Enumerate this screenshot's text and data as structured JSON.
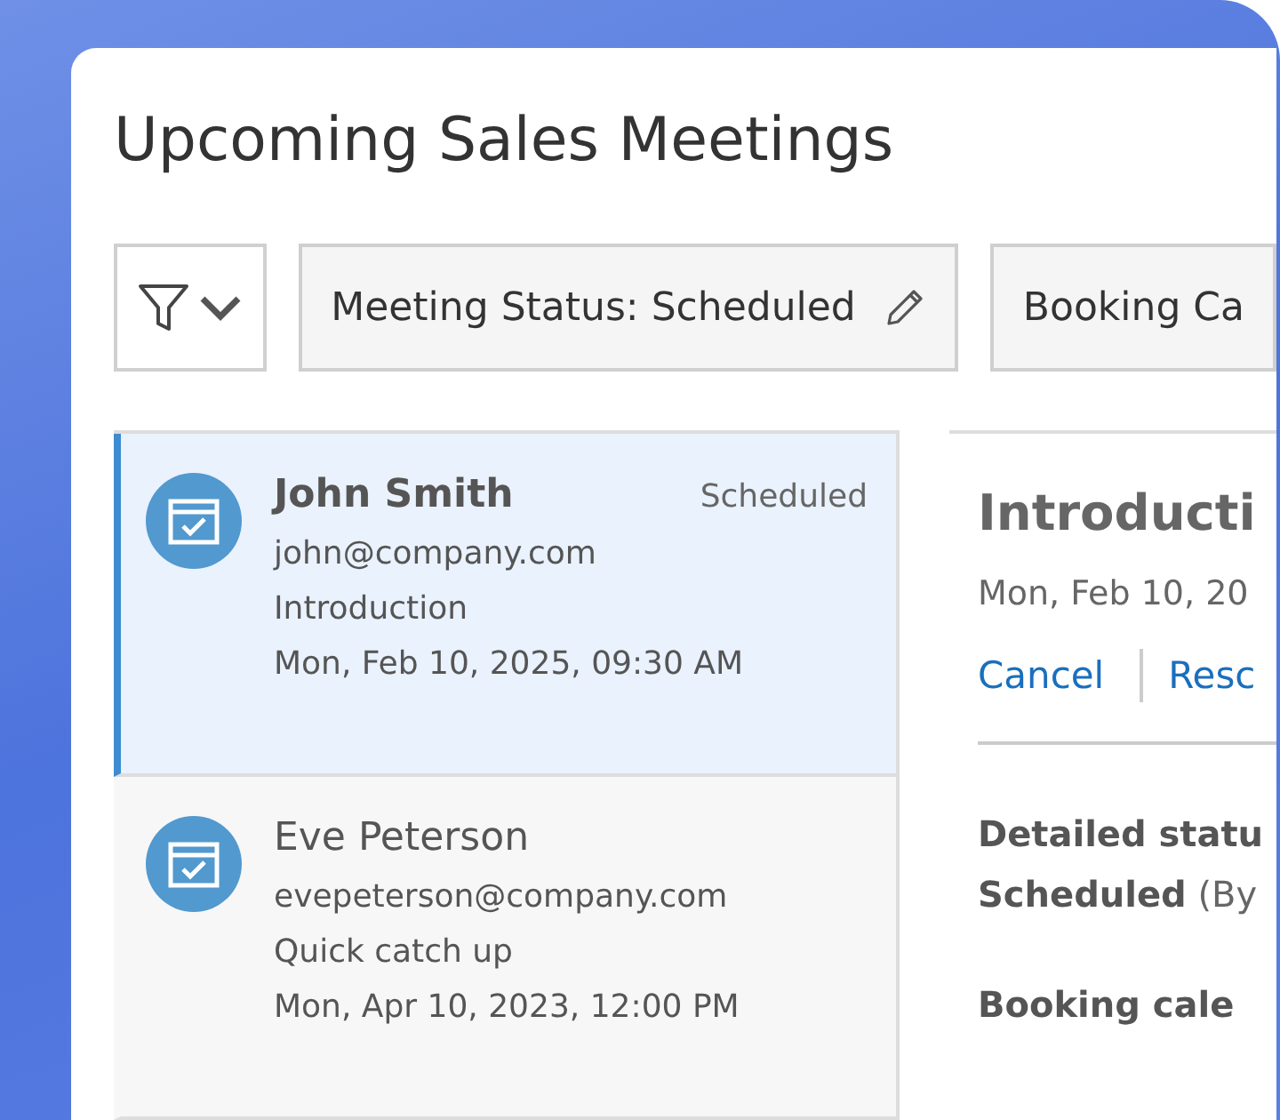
{
  "title": "Upcoming Sales Meetings",
  "filters": [
    {
      "label": "Meeting Status: Scheduled",
      "editable": true
    },
    {
      "label": "Booking Ca",
      "editable": false
    }
  ],
  "meetings": [
    {
      "name": "John Smith",
      "status": "Scheduled",
      "email": "john@company.com",
      "topic": "Introduction",
      "datetime": "Mon, Feb 10, 2025, 09:30 AM",
      "selected": true
    },
    {
      "name": "Eve Peterson",
      "email": "evepeterson@company.com",
      "topic": "Quick catch up",
      "datetime": "Mon, Apr 10, 2023, 12:00 PM",
      "selected": false
    }
  ],
  "detail": {
    "title": "Introducti",
    "datetime": "Mon, Feb 10, 20",
    "actions": [
      "Cancel",
      "Resc"
    ],
    "fields": [
      {
        "label": "Detailed statu",
        "value": "**Scheduled** (By"
      },
      {
        "label": "Booking cale"
      }
    ]
  }
}
